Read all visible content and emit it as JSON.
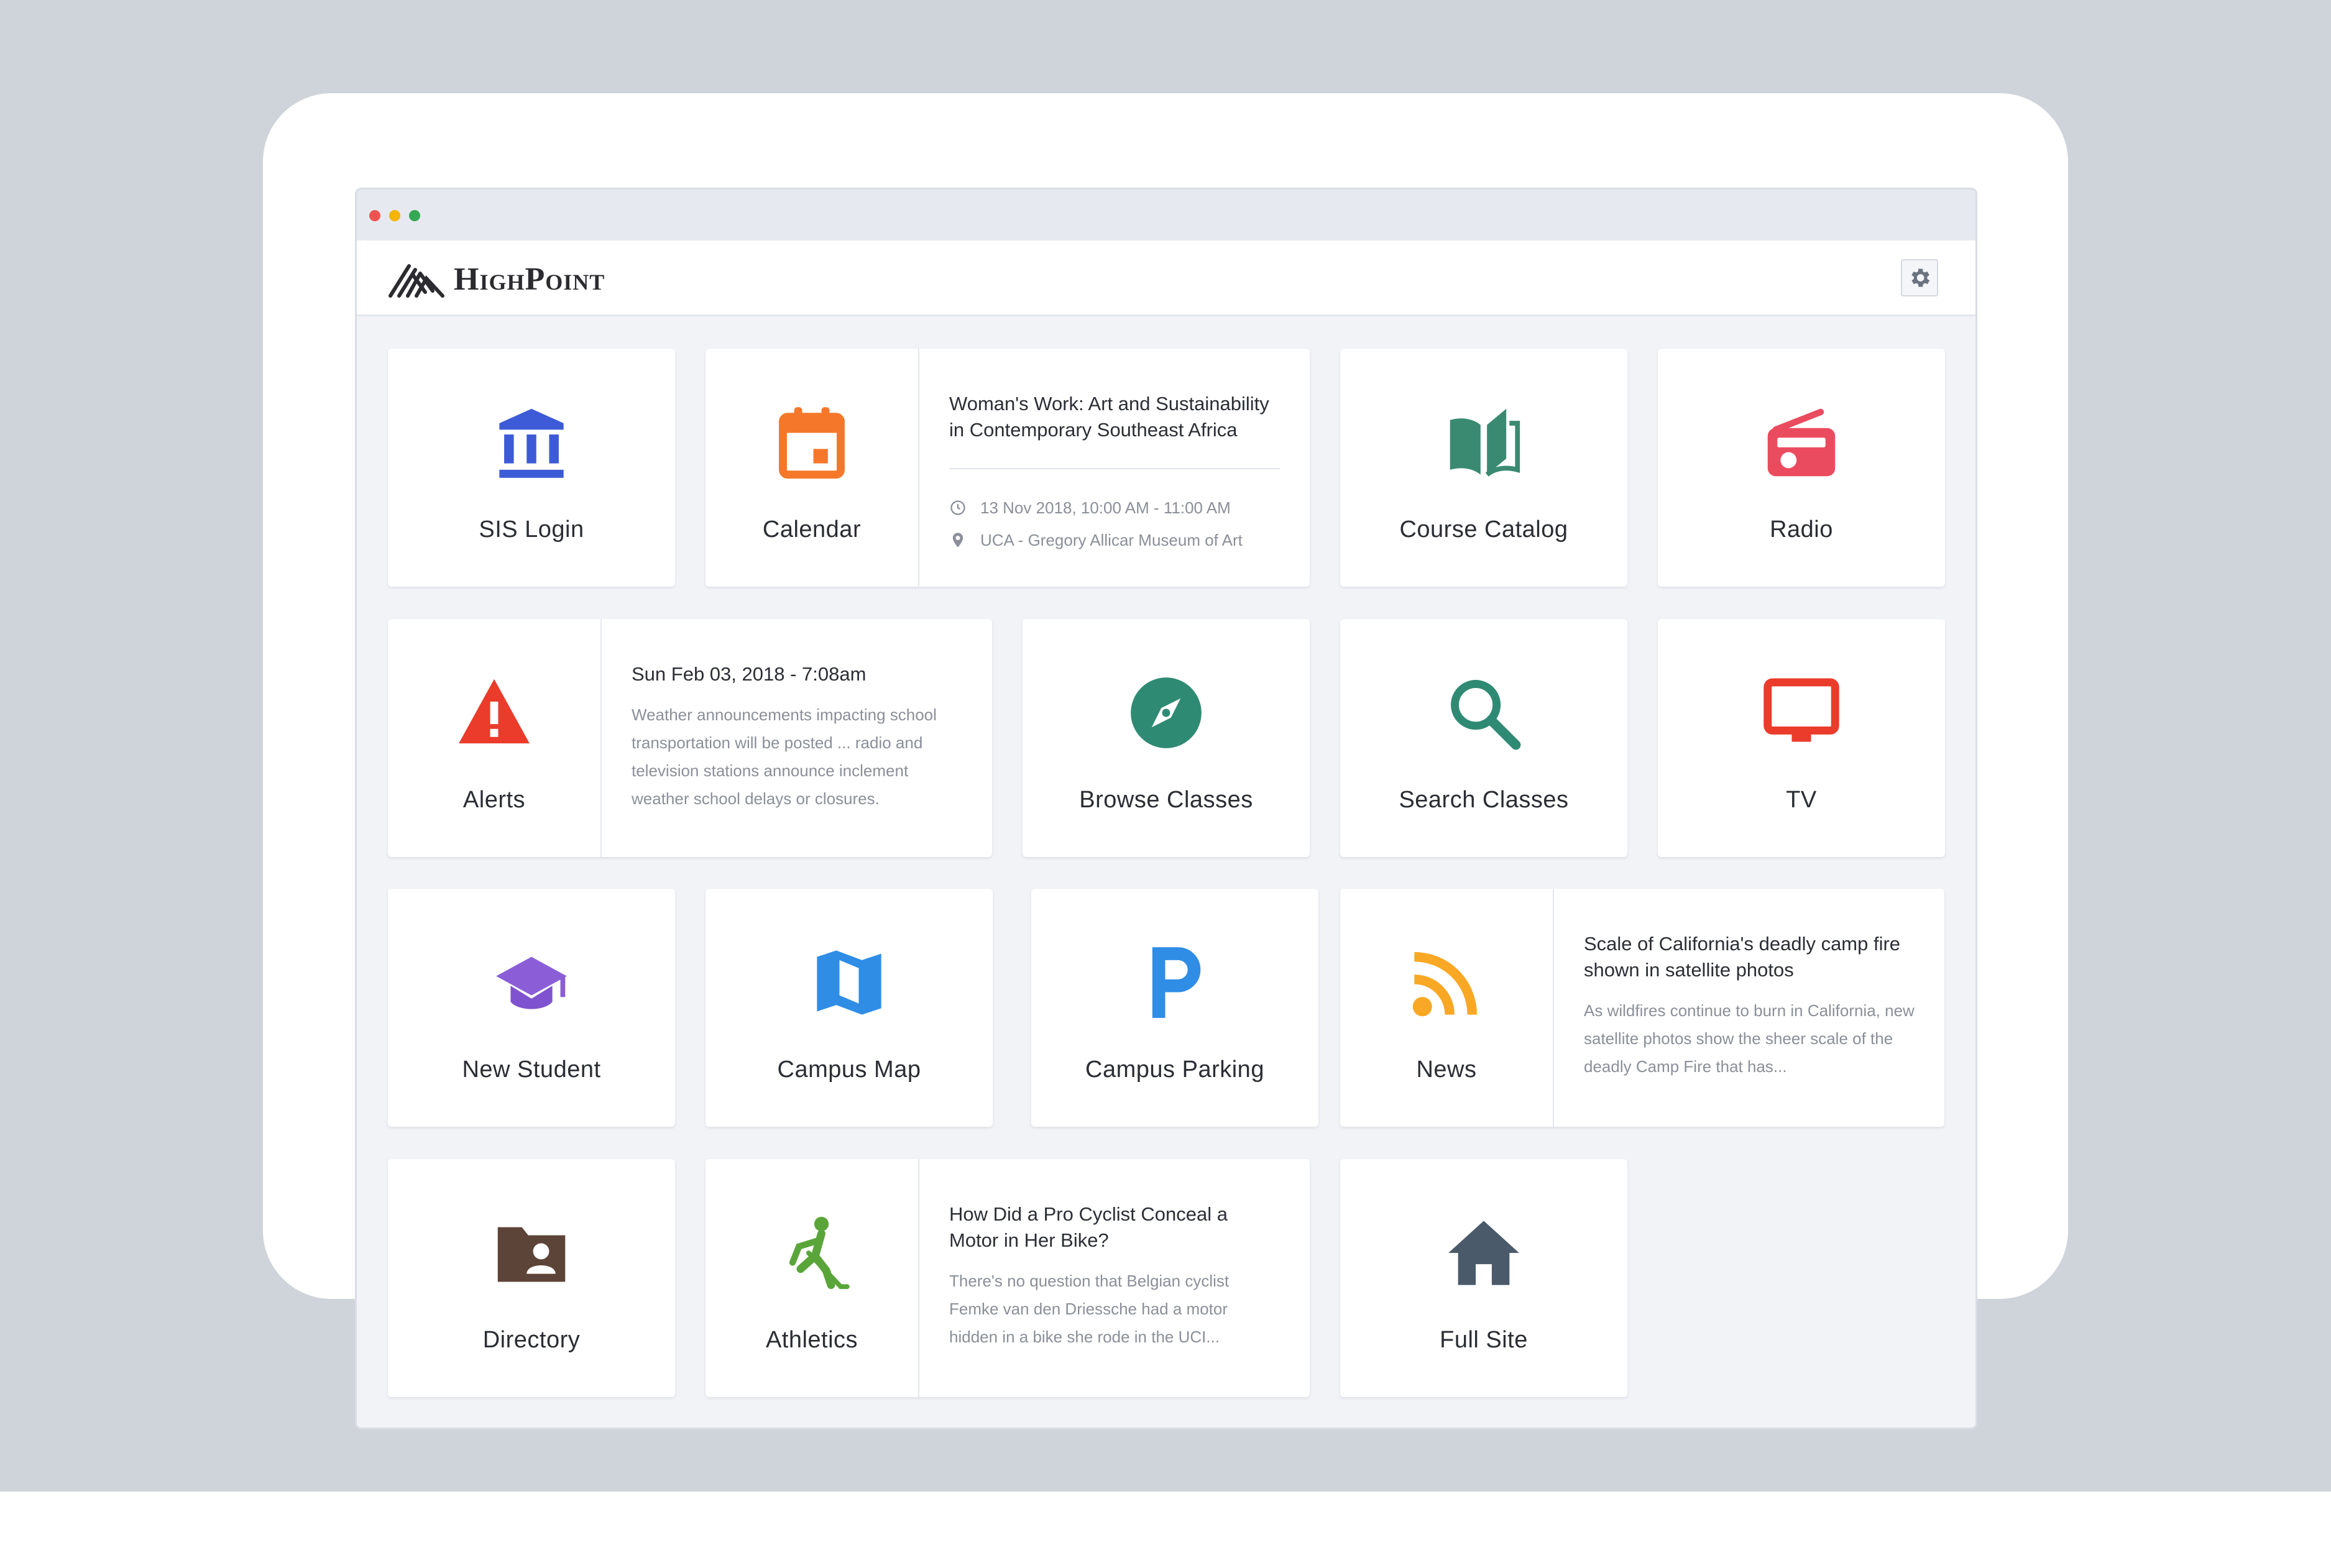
{
  "app": {
    "name": "HighPoint"
  },
  "colors": {
    "sis": "#3d5bd6",
    "calendar": "#f5782a",
    "catalog": "#3a8a72",
    "radio": "#eb4b5f",
    "alerts": "#ea3b2b",
    "browse": "#2f8a73",
    "search": "#2f8a73",
    "tv": "#ea3b2b",
    "student": "#8b5ed8",
    "map": "#2f8de6",
    "parking": "#2f8de6",
    "news": "#f9a825",
    "directory": "#5d4438",
    "athletics": "#5aa53a",
    "fullsite": "#4a5a6a"
  },
  "tiles": {
    "sis": {
      "label": "SIS Login",
      "icon": "bank-icon"
    },
    "calendar": {
      "label": "Calendar",
      "icon": "calendar-icon",
      "event_title": "Woman's Work: Art and Sustainability in Contemporary Southeast Africa",
      "event_time": "13 Nov 2018, 10:00 AM - 11:00 AM",
      "event_location": "UCA - Gregory Allicar Museum of Art"
    },
    "catalog": {
      "label": "Course Catalog",
      "icon": "open-book-icon"
    },
    "radio": {
      "label": "Radio",
      "icon": "radio-icon"
    },
    "alerts": {
      "label": "Alerts",
      "icon": "warning-icon",
      "alert_date": "Sun Feb 03, 2018 - 7:08am",
      "alert_text": "Weather announcements impacting school transportation will be posted ... radio and television stations announce inclement weather school delays or closures."
    },
    "browse": {
      "label": "Browse Classes",
      "icon": "compass-icon"
    },
    "search": {
      "label": "Search Classes",
      "icon": "search-icon"
    },
    "tv": {
      "label": "TV",
      "icon": "tv-icon"
    },
    "student": {
      "label": "New Student",
      "icon": "graduation-cap-icon"
    },
    "map": {
      "label": "Campus Map",
      "icon": "map-icon"
    },
    "parking": {
      "label": "Campus Parking",
      "icon": "parking-icon"
    },
    "news": {
      "label": "News",
      "icon": "rss-icon",
      "story_title": "Scale of California's deadly camp fire shown in satellite photos",
      "story_text": "As wildfires continue to burn in California, new satellite photos show the sheer scale of the deadly Camp Fire that has..."
    },
    "directory": {
      "label": "Directory",
      "icon": "contact-folder-icon"
    },
    "athletics": {
      "label": "Athletics",
      "icon": "hockey-player-icon",
      "story_title": "How Did a Pro Cyclist Conceal a Motor in Her Bike?",
      "story_text": "There's no question that Belgian cyclist Femke van den Driessche had a motor hidden in a bike she rode in the UCI..."
    },
    "fullsite": {
      "label": "Full Site",
      "icon": "home-icon"
    }
  }
}
